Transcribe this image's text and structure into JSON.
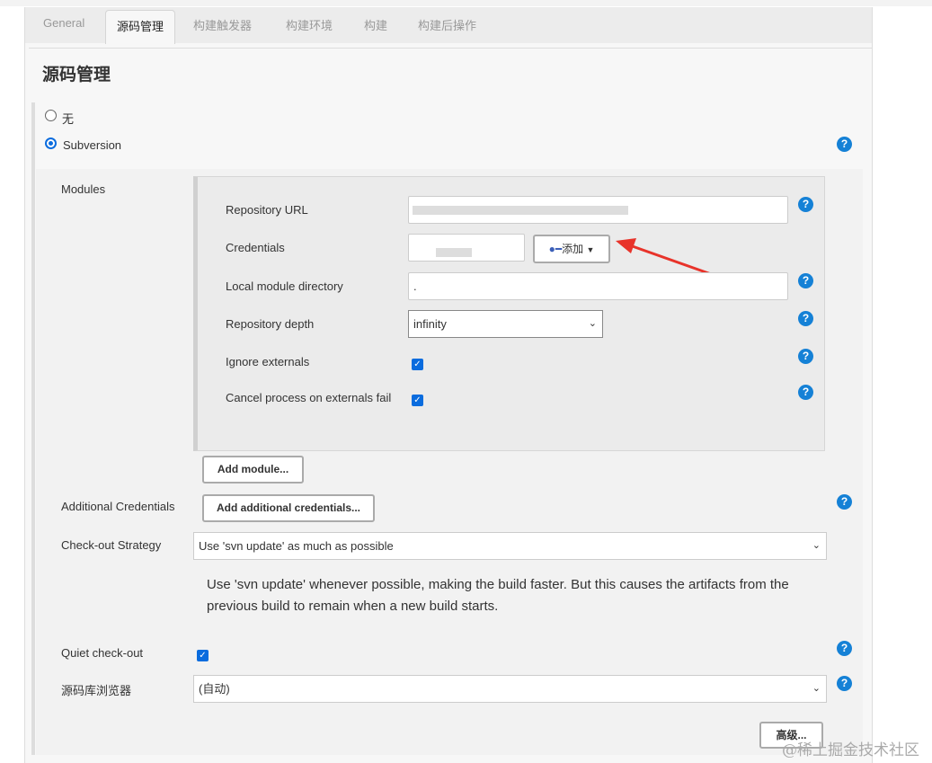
{
  "tabs": [
    "General",
    "源码管理",
    "构建触发器",
    "构建环境",
    "构建",
    "构建后操作"
  ],
  "heading": "源码管理",
  "scm_options": [
    "无",
    "Subversion"
  ],
  "modules": {
    "label": "Modules",
    "repo_url_label": "Repository URL",
    "credentials_label": "Credentials",
    "add_button": "添加",
    "local_dir_label": "Local module directory",
    "local_dir_value": ".",
    "depth_label": "Repository depth",
    "depth_value": "infinity",
    "ignore_externals_label": "Ignore externals",
    "cancel_externals_label": "Cancel process on externals fail",
    "add_module_button": "Add module..."
  },
  "additional_credentials_label": "Additional Credentials",
  "add_additional_credentials_button": "Add additional credentials...",
  "checkout_strategy_label": "Check-out Strategy",
  "checkout_strategy_value": "Use 'svn update' as much as possible",
  "checkout_strategy_desc": "Use 'svn update' whenever possible, making the build faster. But this causes the artifacts from the previous build to remain when a new build starts.",
  "quiet_checkout_label": "Quiet check-out",
  "repo_browser_label": "源码库浏览器",
  "repo_browser_value": "(自动)",
  "advanced_button": "高级...",
  "watermark": "@稀土掘金技术社区",
  "colors": {
    "accent": "#1581d6",
    "arrow": "#e8332a"
  }
}
